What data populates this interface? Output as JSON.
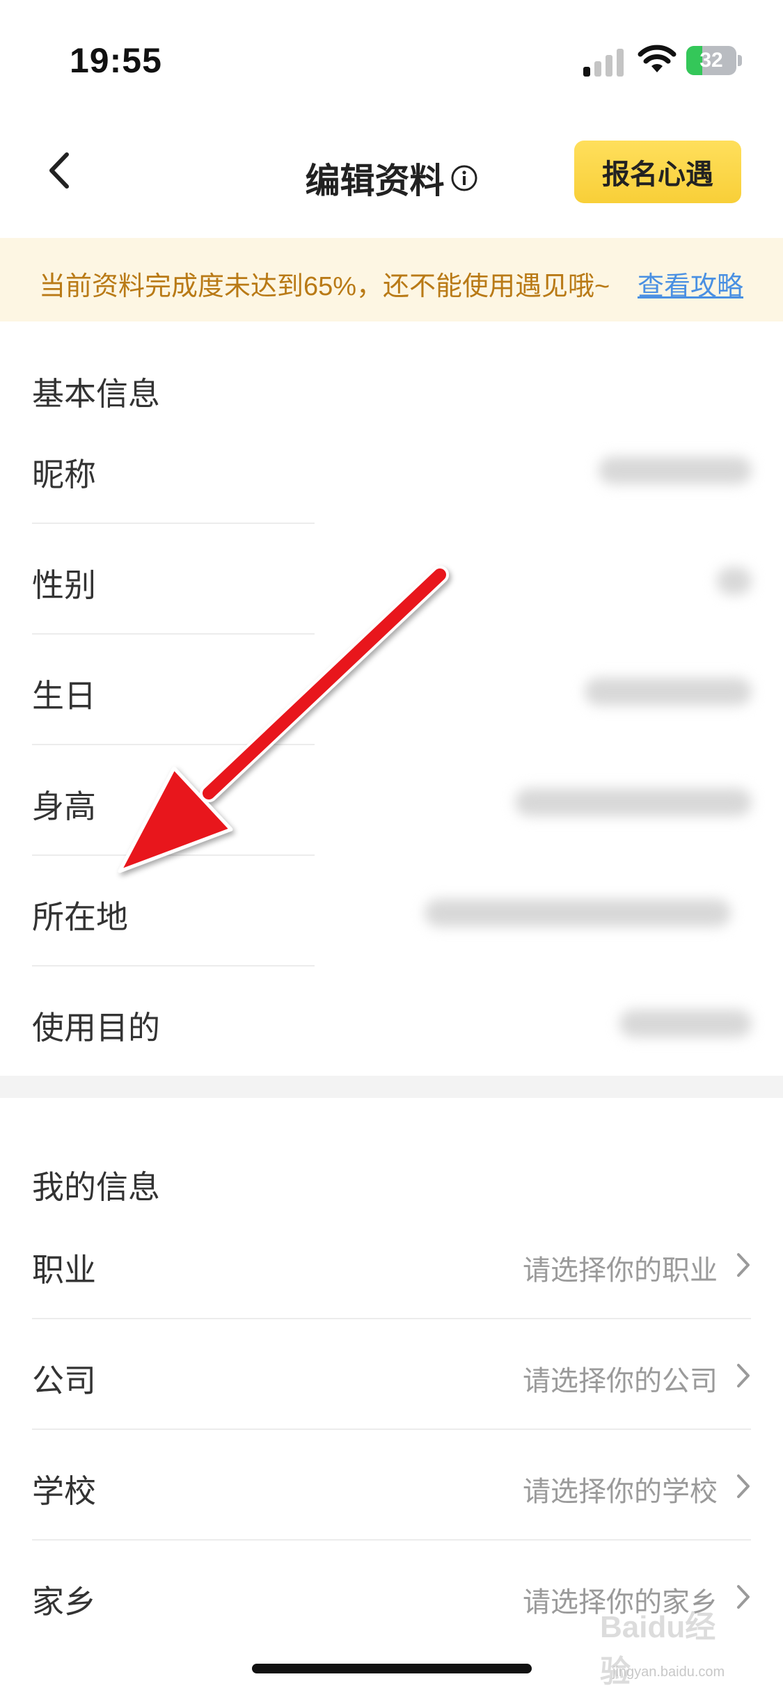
{
  "status_bar": {
    "time": "19:55",
    "battery_level": "32",
    "battery_fraction": 0.32,
    "signal_bars_active": 1,
    "signal_bars_total": 4
  },
  "nav": {
    "back_icon": "chevron-left-icon",
    "title": "编辑资料",
    "info_icon": "info-circle-icon",
    "signup_label": "报名心遇"
  },
  "notice": {
    "text": "当前资料完成度未达到65%，还不能使用遇见哦~",
    "link": "查看攻略",
    "color": "#b97a16",
    "link_color": "#4a90e2",
    "background": "#fdf6e3"
  },
  "basic_info": {
    "title": "基本信息",
    "rows": [
      {
        "label": "昵称"
      },
      {
        "label": "性别"
      },
      {
        "label": "生日"
      },
      {
        "label": "身高"
      },
      {
        "label": "所在地"
      },
      {
        "label": "使用目的"
      }
    ]
  },
  "my_info": {
    "title": "我的信息",
    "rows": [
      {
        "label": "职业",
        "placeholder": "请选择你的职业"
      },
      {
        "label": "公司",
        "placeholder": "请选择你的公司"
      },
      {
        "label": "学校",
        "placeholder": "请选择你的学校"
      },
      {
        "label": "家乡",
        "placeholder": "请选择你的家乡"
      }
    ]
  },
  "annotation": {
    "arrow_color": "#e8141b",
    "icon": "red-arrow-annotation"
  },
  "watermark": {
    "text": "Baidu经验",
    "sub": "jingyan.baidu.com"
  }
}
